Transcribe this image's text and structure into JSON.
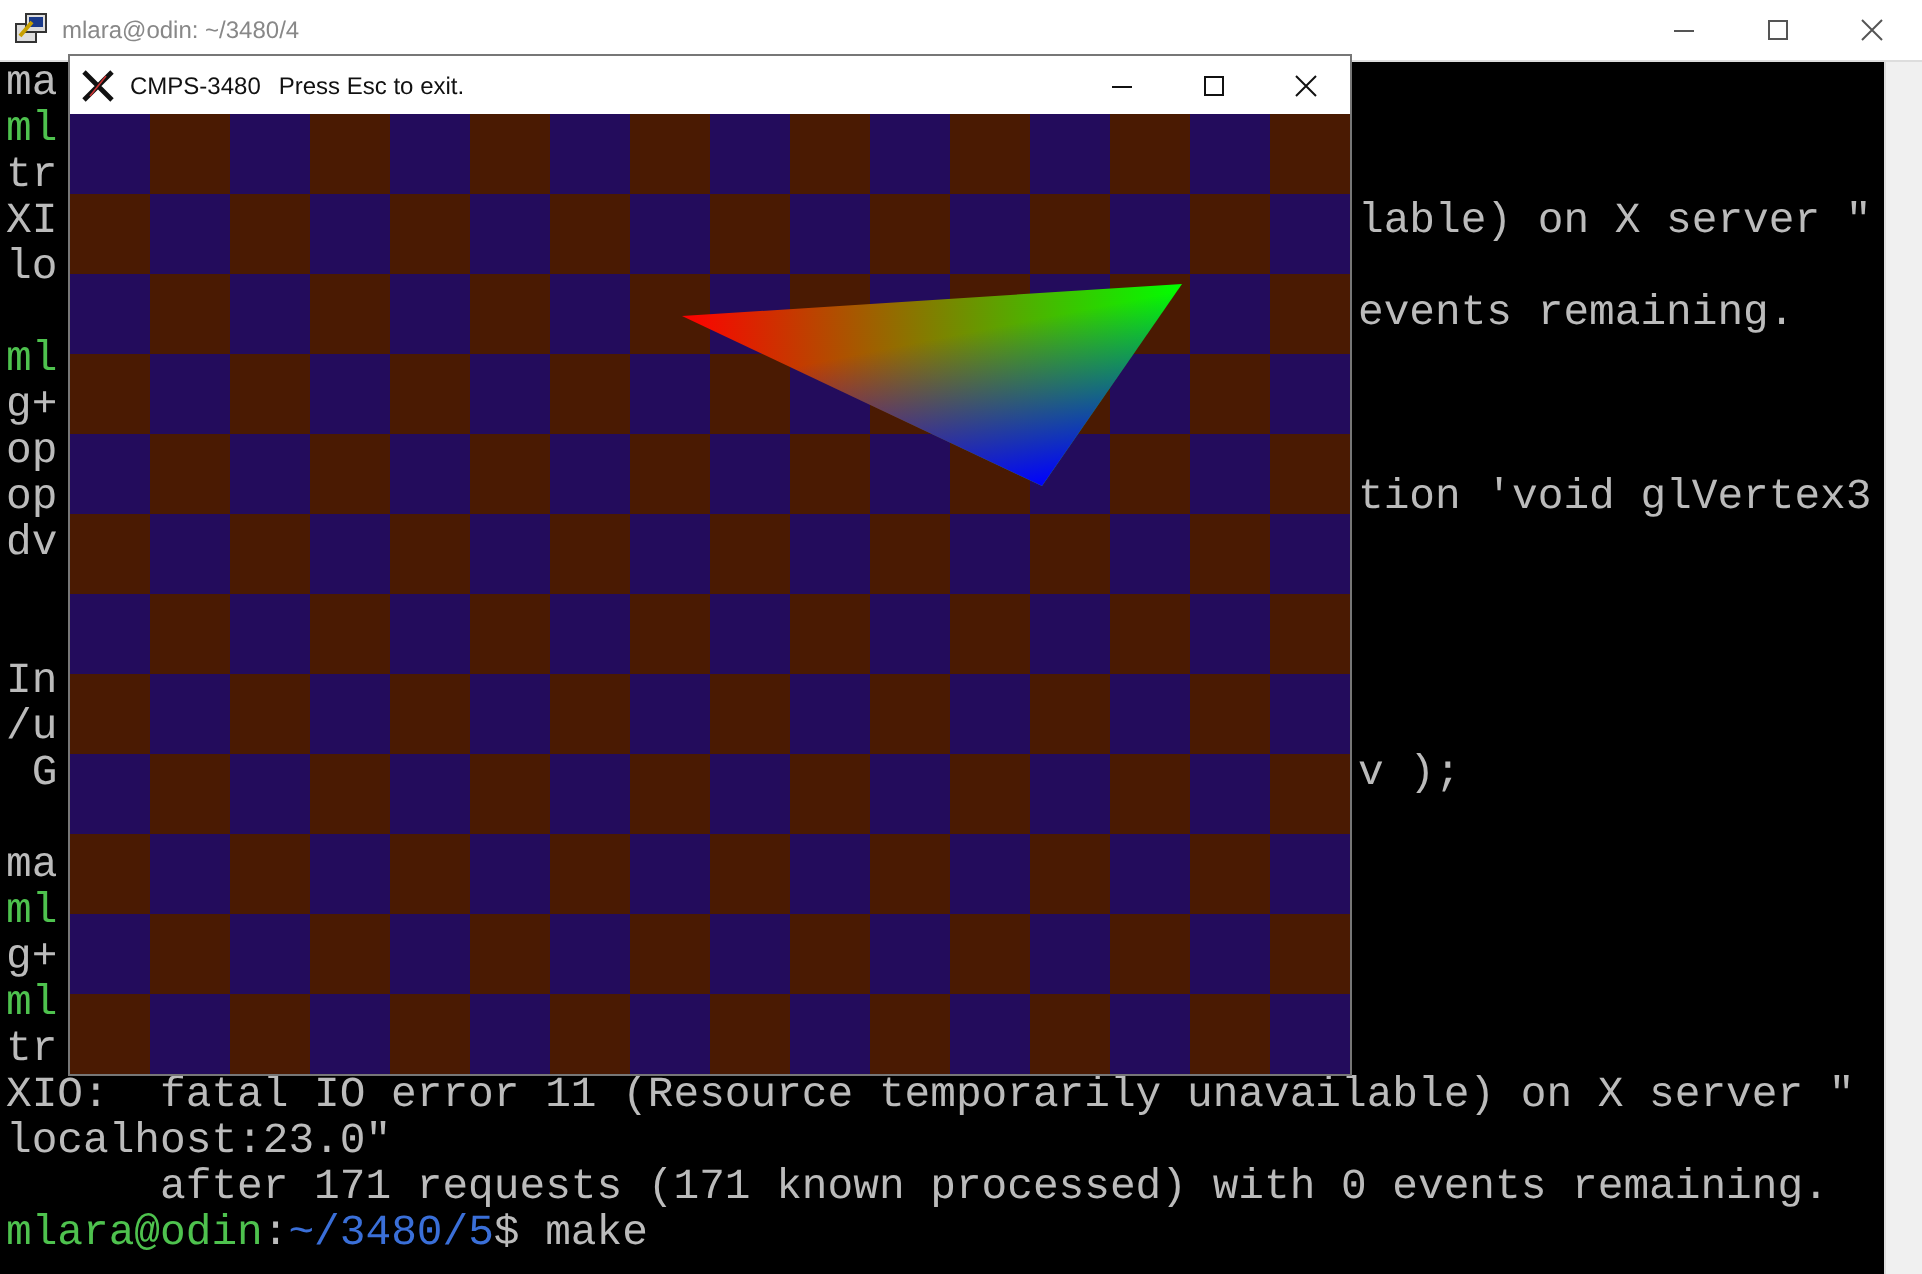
{
  "terminal_window": {
    "title": "mlara@odin: ~/3480/4"
  },
  "terminal": {
    "lines": [
      {
        "kind": "text",
        "segments": [
          {
            "kind": "plain",
            "text": "ma"
          }
        ]
      },
      {
        "kind": "text",
        "segments": [
          {
            "kind": "user",
            "text": "ml"
          }
        ]
      },
      {
        "kind": "text",
        "segments": [
          {
            "kind": "plain",
            "text": "tr"
          }
        ]
      },
      {
        "kind": "text",
        "segments": [
          {
            "kind": "plain",
            "text": "XI"
          }
        ],
        "right": "lable) on X server \""
      },
      {
        "kind": "text",
        "segments": [
          {
            "kind": "plain",
            "text": "lo"
          }
        ]
      },
      {
        "kind": "text",
        "right": "events remaining."
      },
      {
        "kind": "text",
        "segments": [
          {
            "kind": "user",
            "text": "ml"
          }
        ]
      },
      {
        "kind": "text",
        "segments": [
          {
            "kind": "plain",
            "text": "g+"
          }
        ]
      },
      {
        "kind": "text",
        "segments": [
          {
            "kind": "plain",
            "text": "op"
          }
        ]
      },
      {
        "kind": "text",
        "segments": [
          {
            "kind": "plain",
            "text": "op"
          }
        ],
        "right": "tion 'void glVertex3"
      },
      {
        "kind": "text",
        "segments": [
          {
            "kind": "plain",
            "text": "dv"
          }
        ]
      },
      {
        "kind": "blank"
      },
      {
        "kind": "blank"
      },
      {
        "kind": "text",
        "segments": [
          {
            "kind": "plain",
            "text": "In"
          }
        ]
      },
      {
        "kind": "text",
        "segments": [
          {
            "kind": "plain",
            "text": "/u"
          }
        ]
      },
      {
        "kind": "text",
        "segments": [
          {
            "kind": "plain",
            "text": " G"
          }
        ],
        "right": "v );"
      },
      {
        "kind": "blank"
      },
      {
        "kind": "text",
        "segments": [
          {
            "kind": "plain",
            "text": "ma"
          }
        ]
      },
      {
        "kind": "text",
        "segments": [
          {
            "kind": "user",
            "text": "ml"
          }
        ]
      },
      {
        "kind": "text",
        "segments": [
          {
            "kind": "plain",
            "text": "g+"
          }
        ]
      },
      {
        "kind": "text",
        "segments": [
          {
            "kind": "user",
            "text": "ml"
          }
        ]
      },
      {
        "kind": "text",
        "segments": [
          {
            "kind": "plain",
            "text": "tr"
          }
        ]
      },
      {
        "kind": "text",
        "segments": [
          {
            "kind": "plain",
            "text": "XIO:  fatal IO error 11 (Resource temporarily unavailable) on X server \""
          }
        ]
      },
      {
        "kind": "text",
        "segments": [
          {
            "kind": "plain",
            "text": "localhost:23.0\""
          }
        ]
      },
      {
        "kind": "text",
        "segments": [
          {
            "kind": "plain",
            "text": "      after 171 requests (171 known processed) with 0 events remaining."
          }
        ]
      },
      {
        "kind": "text",
        "segments": [
          {
            "kind": "user",
            "text": "mlara@odin"
          },
          {
            "kind": "plain",
            "text": ":"
          },
          {
            "kind": "path",
            "text": "~/3480/5"
          },
          {
            "kind": "plain",
            "text": "$ make"
          }
        ]
      }
    ]
  },
  "gl_window": {
    "title": "CMPS-3480",
    "subtitle": "Press Esc to exit."
  }
}
